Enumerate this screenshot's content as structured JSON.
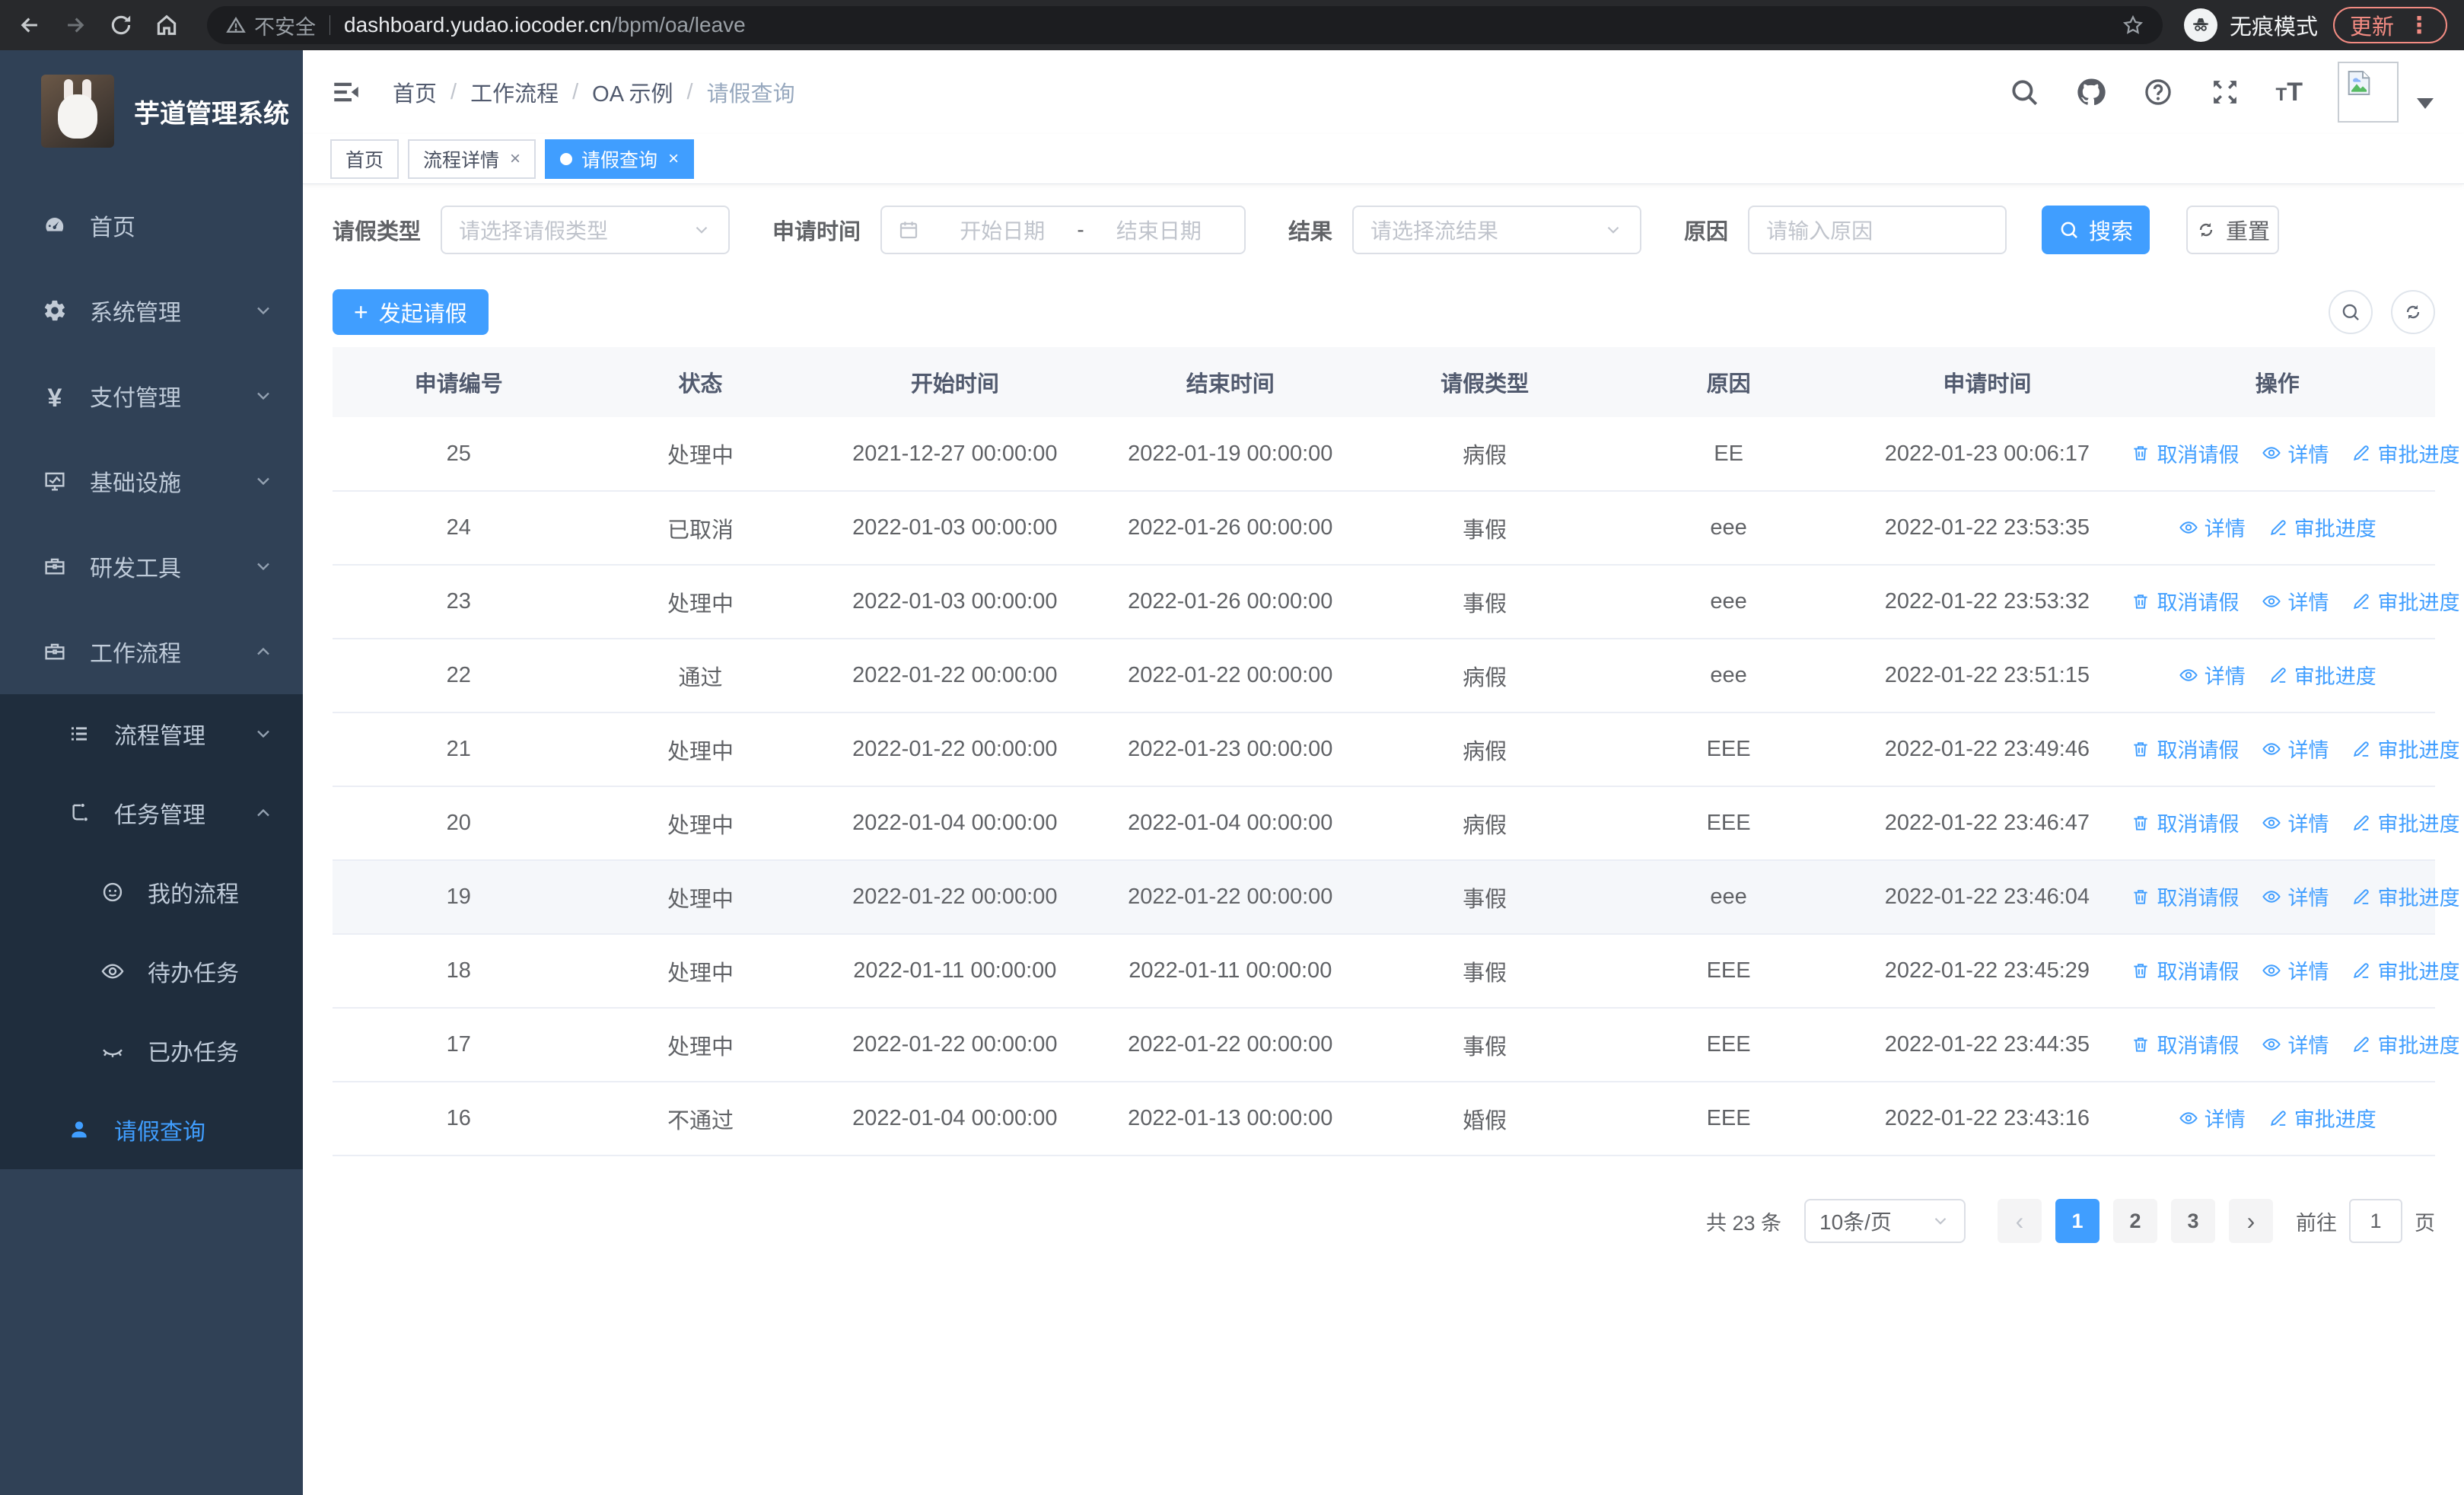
{
  "colors": {
    "primary": "#409EFF",
    "sidebar_bg": "#304156",
    "submenu_bg": "#1f2d3d",
    "update_accent": "#f28b82"
  },
  "browser": {
    "security_label": "不安全",
    "url_host": "dashboard.yudao.iocoder.cn",
    "url_path": "/bpm/oa/leave",
    "incognito_label": "无痕模式",
    "update_label": "更新"
  },
  "sidebar": {
    "title": "芋道管理系统",
    "items": [
      {
        "label": "首页",
        "icon": "gauge",
        "level": 1
      },
      {
        "label": "系统管理",
        "icon": "gear",
        "level": 1,
        "chevron": "down"
      },
      {
        "label": "支付管理",
        "icon": "yen",
        "level": 1,
        "chevron": "down"
      },
      {
        "label": "基础设施",
        "icon": "monitor",
        "level": 1,
        "chevron": "down"
      },
      {
        "label": "研发工具",
        "icon": "briefcase",
        "level": 1,
        "chevron": "down"
      },
      {
        "label": "工作流程",
        "icon": "briefcase",
        "level": 1,
        "chevron": "up"
      },
      {
        "label": "流程管理",
        "icon": "list",
        "level": 2,
        "chevron": "down",
        "group": true
      },
      {
        "label": "任务管理",
        "icon": "flow",
        "level": 2,
        "chevron": "up",
        "group": true
      },
      {
        "label": "我的流程",
        "icon": "face",
        "level": 3,
        "group": true
      },
      {
        "label": "待办任务",
        "icon": "eye",
        "level": 3,
        "group": true
      },
      {
        "label": "已办任务",
        "icon": "eyeclosed",
        "level": 3,
        "group": true
      },
      {
        "label": "请假查询",
        "icon": "user",
        "level": 2,
        "group": true,
        "active": true
      }
    ]
  },
  "header": {
    "breadcrumb": [
      {
        "label": "首页"
      },
      {
        "label": "工作流程"
      },
      {
        "label": "OA 示例"
      },
      {
        "label": "请假查询",
        "current": true
      }
    ]
  },
  "tabs": [
    {
      "label": "首页"
    },
    {
      "label": "流程详情",
      "closable": true
    },
    {
      "label": "请假查询",
      "closable": true,
      "active": true
    }
  ],
  "filters": {
    "type_label": "请假类型",
    "type_placeholder": "请选择请假类型",
    "time_label": "申请时间",
    "start_placeholder": "开始日期",
    "range_separator": "-",
    "end_placeholder": "结束日期",
    "result_label": "结果",
    "result_placeholder": "请选择流结果",
    "reason_label": "原因",
    "reason_placeholder": "请输入原因",
    "search_label": "搜索",
    "reset_label": "重置"
  },
  "toolbar": {
    "create_label": "发起请假",
    "plus": "+"
  },
  "table": {
    "headers": [
      "申请编号",
      "状态",
      "开始时间",
      "结束时间",
      "请假类型",
      "原因",
      "申请时间",
      "操作"
    ],
    "action_labels": {
      "cancel": "取消请假",
      "detail": "详情",
      "progress": "审批进度"
    },
    "rows": [
      {
        "id": "25",
        "status": "处理中",
        "start": "2021-12-27 00:00:00",
        "end": "2022-01-19 00:00:00",
        "type": "病假",
        "reason": "EE",
        "applied": "2022-01-23 00:06:17",
        "actions": [
          "cancel",
          "detail",
          "progress"
        ]
      },
      {
        "id": "24",
        "status": "已取消",
        "start": "2022-01-03 00:00:00",
        "end": "2022-01-26 00:00:00",
        "type": "事假",
        "reason": "eee",
        "applied": "2022-01-22 23:53:35",
        "actions": [
          "detail",
          "progress"
        ]
      },
      {
        "id": "23",
        "status": "处理中",
        "start": "2022-01-03 00:00:00",
        "end": "2022-01-26 00:00:00",
        "type": "事假",
        "reason": "eee",
        "applied": "2022-01-22 23:53:32",
        "actions": [
          "cancel",
          "detail",
          "progress"
        ]
      },
      {
        "id": "22",
        "status": "通过",
        "start": "2022-01-22 00:00:00",
        "end": "2022-01-22 00:00:00",
        "type": "病假",
        "reason": "eee",
        "applied": "2022-01-22 23:51:15",
        "actions": [
          "detail",
          "progress"
        ]
      },
      {
        "id": "21",
        "status": "处理中",
        "start": "2022-01-22 00:00:00",
        "end": "2022-01-23 00:00:00",
        "type": "病假",
        "reason": "EEE",
        "applied": "2022-01-22 23:49:46",
        "actions": [
          "cancel",
          "detail",
          "progress"
        ]
      },
      {
        "id": "20",
        "status": "处理中",
        "start": "2022-01-04 00:00:00",
        "end": "2022-01-04 00:00:00",
        "type": "病假",
        "reason": "EEE",
        "applied": "2022-01-22 23:46:47",
        "actions": [
          "cancel",
          "detail",
          "progress"
        ]
      },
      {
        "id": "19",
        "status": "处理中",
        "start": "2022-01-22 00:00:00",
        "end": "2022-01-22 00:00:00",
        "type": "事假",
        "reason": "eee",
        "applied": "2022-01-22 23:46:04",
        "actions": [
          "cancel",
          "detail",
          "progress"
        ],
        "highlight": true
      },
      {
        "id": "18",
        "status": "处理中",
        "start": "2022-01-11 00:00:00",
        "end": "2022-01-11 00:00:00",
        "type": "事假",
        "reason": "EEE",
        "applied": "2022-01-22 23:45:29",
        "actions": [
          "cancel",
          "detail",
          "progress"
        ]
      },
      {
        "id": "17",
        "status": "处理中",
        "start": "2022-01-22 00:00:00",
        "end": "2022-01-22 00:00:00",
        "type": "事假",
        "reason": "EEE",
        "applied": "2022-01-22 23:44:35",
        "actions": [
          "cancel",
          "detail",
          "progress"
        ]
      },
      {
        "id": "16",
        "status": "不通过",
        "start": "2022-01-04 00:00:00",
        "end": "2022-01-13 00:00:00",
        "type": "婚假",
        "reason": "EEE",
        "applied": "2022-01-22 23:43:16",
        "actions": [
          "detail",
          "progress"
        ]
      }
    ]
  },
  "pagination": {
    "total_label": "共 23 条",
    "page_size_label": "10条/页",
    "prev": "‹",
    "next": "›",
    "pages": [
      "1",
      "2",
      "3"
    ],
    "current_page": "1",
    "goto_label": "前往",
    "goto_value": "1",
    "page_unit": "页"
  }
}
